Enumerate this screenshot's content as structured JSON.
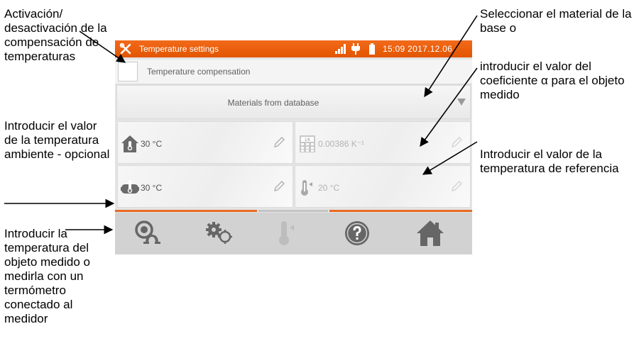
{
  "annotations": {
    "left": [
      "Activación/ desactivación de la compensación de temperaturas",
      "Introducir el valor de la temperatura ambiente - opcional",
      "Introducir la temperatura del objeto medido o medirla con un termómetro conectado al medidor"
    ],
    "right": [
      "Seleccionar el material de la base o",
      "introducir el valor del coeficiente α para el objeto medido",
      "Introducir el valor de la temperatura de referencia"
    ]
  },
  "screen": {
    "title": "Temperature settings",
    "clock": "15:09 2017.12.06",
    "compensation_label": "Temperature compensation",
    "material_dropdown": "Materials from database",
    "ambient_value": "30 °C",
    "alpha_value": "0.00386 K⁻¹",
    "alpha_icon_text": "1/K",
    "object_value": "30 °C",
    "reference_value": "20 °C",
    "accent_color": "#e86a22"
  }
}
